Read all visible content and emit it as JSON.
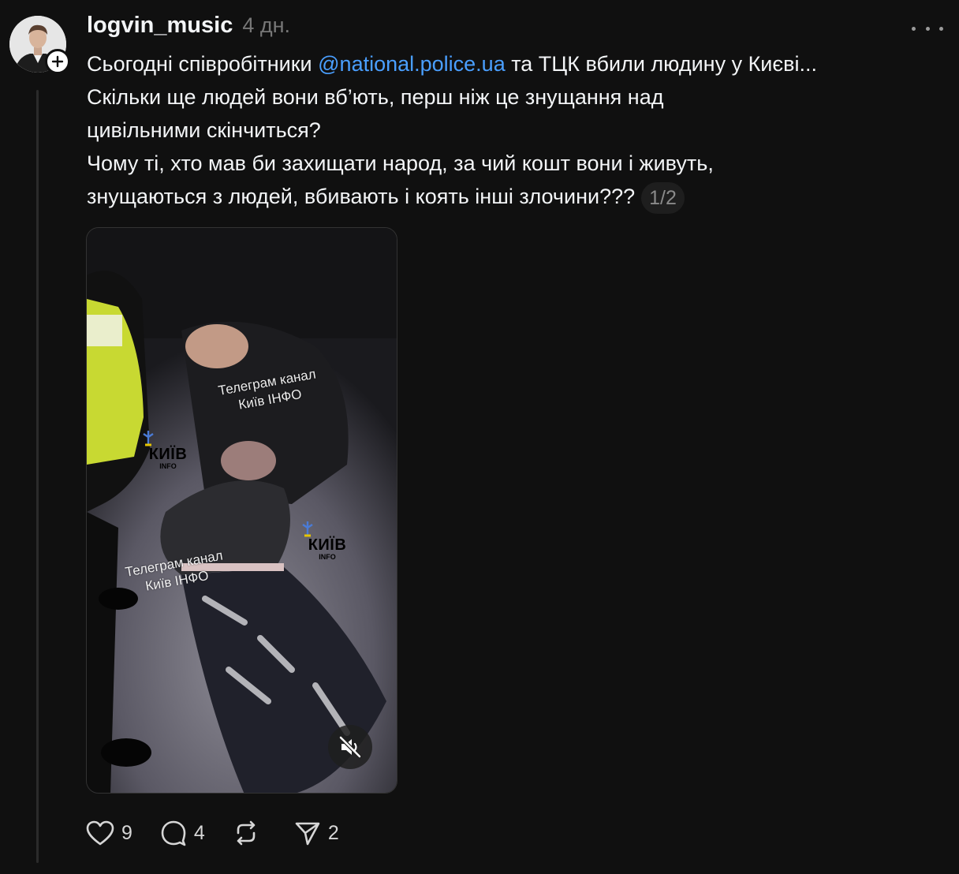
{
  "post": {
    "username": "logvin_music",
    "timestamp": "4 дн.",
    "caption": {
      "line1_before": "Сьогодні співробітники ",
      "mention": "@national.police.ua",
      "line1_after": " та ТЦК вбили людину у Києві...",
      "line2": "Скільки ще людей вони вб’ють, перш ніж це знущання над",
      "line3": "цивільними скінчиться?",
      "line4": "Чому ті, хто мав би захищати народ, за чий кошт вони і живуть,",
      "line5": "знущаються з людей, вбивають і коять інші злочини???"
    },
    "page_indicator": "1/2",
    "media": {
      "watermark1_line1": "Телеграм канал",
      "watermark1_line2": "Київ ІНФО",
      "watermark2_line1": "Телеграм канал",
      "watermark2_line2": "Київ ІНФО",
      "logo_word": "КИЇВ",
      "logo_sub": "INFO",
      "mute_icon": "speaker-muted-icon"
    },
    "actions": {
      "likes": "9",
      "comments": "4",
      "reposts": "",
      "shares": "2"
    },
    "icons": {
      "like": "heart-icon",
      "comment": "comment-bubble-icon",
      "repost": "repost-icon",
      "share": "send-icon",
      "more": "more-dots-icon",
      "follow": "plus-icon"
    },
    "colors": {
      "background": "#101010",
      "mention": "#4a9fff",
      "muted_text": "#777777"
    }
  }
}
